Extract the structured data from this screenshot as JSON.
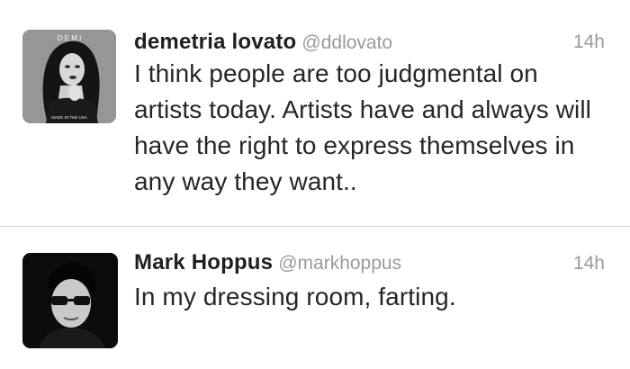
{
  "tweets": [
    {
      "name": "demetria lovato",
      "handle": "@ddlovato",
      "time": "14h",
      "text": "I think people are too judgmental on artists today. Artists have and always will have the right to express themselves in any way they want..",
      "avatar": "demi-album-cover-avatar",
      "avatar_text_top": "D E M I",
      "avatar_text_bottom": "MADE IN THE USA"
    },
    {
      "name": "Mark Hoppus",
      "handle": "@markhoppus",
      "time": "14h",
      "text": "In my dressing room, farting.",
      "avatar": "sunglasses-portrait-avatar"
    }
  ]
}
